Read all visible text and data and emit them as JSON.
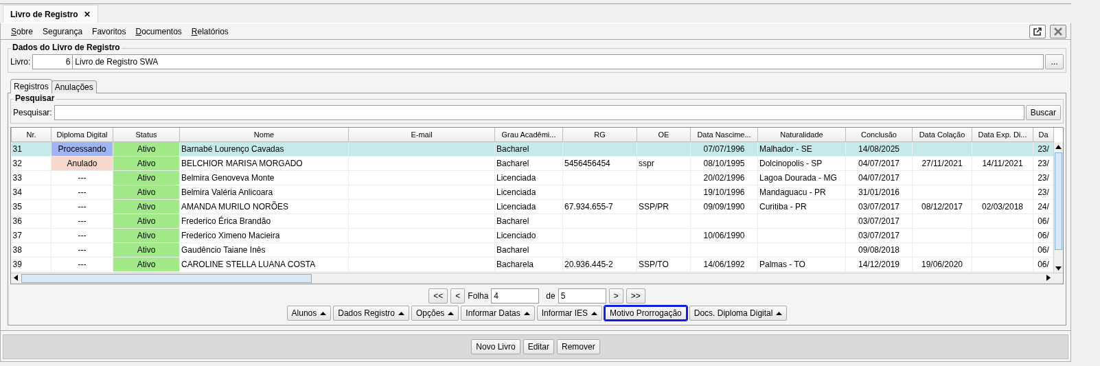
{
  "document_tab": {
    "title": "Livro de Registro",
    "close": "✕"
  },
  "menu": [
    {
      "label": "Sobre",
      "mnemonic": true
    },
    {
      "label": "Segurança",
      "mnemonic": false
    },
    {
      "label": "Favoritos",
      "mnemonic": false
    },
    {
      "label": "Documentos",
      "mnemonic": true
    },
    {
      "label": "Relatórios",
      "mnemonic": true
    }
  ],
  "livro_group": {
    "title": "Dados do Livro de Registro",
    "label": "Livro:",
    "number": "6",
    "name": "Livro de Registro SWA",
    "browse_button": "..."
  },
  "tabs": [
    {
      "label": "Registros",
      "selected": true
    },
    {
      "label": "Anulações",
      "selected": false
    }
  ],
  "search": {
    "title": "Pesquisar",
    "label": "Pesquisar:",
    "button": "Buscar"
  },
  "table": {
    "columns": [
      "Nr.",
      "Diploma Digital",
      "Status",
      "Nome",
      "E-mail",
      "Grau Acadêmi...",
      "RG",
      "OE",
      "Data Nascime...",
      "Naturalidade",
      "Conclusão",
      "Data Colação",
      "Data Exp. Di...",
      "Da"
    ],
    "rows": [
      {
        "selected": true,
        "nr": "31",
        "diploma_digital": {
          "text": "Processando",
          "color": "#9fb5f5"
        },
        "status": {
          "text": "Ativo",
          "color": "#a2e98a"
        },
        "nome": "Barnabé Lourenço Cavadas",
        "grau": "Bacharel",
        "nascimento": "07/07/1996",
        "naturalidade": "Malhador - SE",
        "conclusao": "14/08/2025",
        "last": "23/"
      },
      {
        "selected": false,
        "nr": "32",
        "diploma_digital": {
          "text": "Anulado",
          "color": "#f9d8cc"
        },
        "status": {
          "text": "Ativo",
          "color": "#a2e98a"
        },
        "nome": "BELCHIOR MARISA MORGADO",
        "grau": "Bacharel",
        "rg": "5456456454",
        "oe": "sspr",
        "nascimento": "08/10/1995",
        "naturalidade": "Dolcinopolis - SP",
        "conclusao": "04/07/2017",
        "colacao": "27/11/2021",
        "expedicao": "14/11/2021",
        "last": "23/"
      },
      {
        "selected": false,
        "nr": "33",
        "diploma_digital": {
          "text": "---"
        },
        "status": {
          "text": "Ativo",
          "color": "#a2e98a"
        },
        "nome": "Belmira Genoveva Monte",
        "grau": "Licenciada",
        "nascimento": "20/02/1996",
        "naturalidade": "Lagoa Dourada - MG",
        "conclusao": "04/07/2017",
        "last": "23/"
      },
      {
        "selected": false,
        "nr": "34",
        "diploma_digital": {
          "text": "---"
        },
        "status": {
          "text": "Ativo",
          "color": "#a2e98a"
        },
        "nome": "Belmira Valéria Anlicoara",
        "grau": "Licenciada",
        "nascimento": "19/10/1996",
        "naturalidade": "Mandaguacu - PR",
        "conclusao": "31/01/2016",
        "last": "23/"
      },
      {
        "selected": false,
        "nr": "35",
        "diploma_digital": {
          "text": "---"
        },
        "status": {
          "text": "Ativo",
          "color": "#a2e98a"
        },
        "nome": "AMANDA MURILO NORÕES",
        "grau": "Licenciada",
        "rg": "67.934.655-7",
        "oe": "SSP/PR",
        "nascimento": "09/09/1990",
        "naturalidade": "Curitiba - PR",
        "conclusao": "03/07/2017",
        "colacao": "08/12/2017",
        "expedicao": "02/03/2018",
        "last": "24/"
      },
      {
        "selected": false,
        "nr": "36",
        "diploma_digital": {
          "text": "---"
        },
        "status": {
          "text": "Ativo",
          "color": "#a2e98a"
        },
        "nome": "Frederico Érica Brandão",
        "grau": "Bacharel",
        "conclusao": "03/07/2017",
        "last": "06/"
      },
      {
        "selected": false,
        "nr": "37",
        "diploma_digital": {
          "text": "---"
        },
        "status": {
          "text": "Ativo",
          "color": "#a2e98a"
        },
        "nome": "Frederico Ximeno Macieira",
        "grau": "Licenciado",
        "nascimento": "10/06/1990",
        "conclusao": "03/07/2017",
        "last": "06/"
      },
      {
        "selected": false,
        "nr": "38",
        "diploma_digital": {
          "text": "---"
        },
        "status": {
          "text": "Ativo",
          "color": "#a2e98a"
        },
        "nome": "Gaudêncio Taiane Inês",
        "grau": "Bacharel",
        "conclusao": "09/08/2018",
        "last": "06/"
      },
      {
        "selected": false,
        "nr": "39",
        "diploma_digital": {
          "text": "---"
        },
        "status": {
          "text": "Ativo",
          "color": "#a2e98a"
        },
        "nome": "CAROLINE STELLA LUANA COSTA",
        "grau": "Bacharela",
        "rg": "20.936.445-2",
        "oe": "SSP/TO",
        "nascimento": "14/06/1992",
        "naturalidade": "Palmas - TO",
        "conclusao": "14/12/2019",
        "colacao": "19/06/2020",
        "last": "06/"
      }
    ]
  },
  "pagination": {
    "first": "<<",
    "prev": "<",
    "label": "Folha",
    "page": "4",
    "of": "de",
    "total": "5",
    "next": ">",
    "last": ">>"
  },
  "actions": [
    {
      "label": "Alunos",
      "has_menu": true,
      "focused": false
    },
    {
      "label": "Dados Registro",
      "has_menu": true,
      "focused": false
    },
    {
      "label": "Opções",
      "has_menu": true,
      "focused": false
    },
    {
      "label": "Informar Datas",
      "has_menu": true,
      "focused": false
    },
    {
      "label": "Informar IES",
      "has_menu": true,
      "focused": false
    },
    {
      "label": "Motivo Prorrogação",
      "has_menu": false,
      "focused": true
    },
    {
      "label": "Docs. Diploma Digital",
      "has_menu": true,
      "focused": false
    }
  ],
  "bottom_buttons": [
    "Novo Livro",
    "Editar",
    "Remover"
  ]
}
